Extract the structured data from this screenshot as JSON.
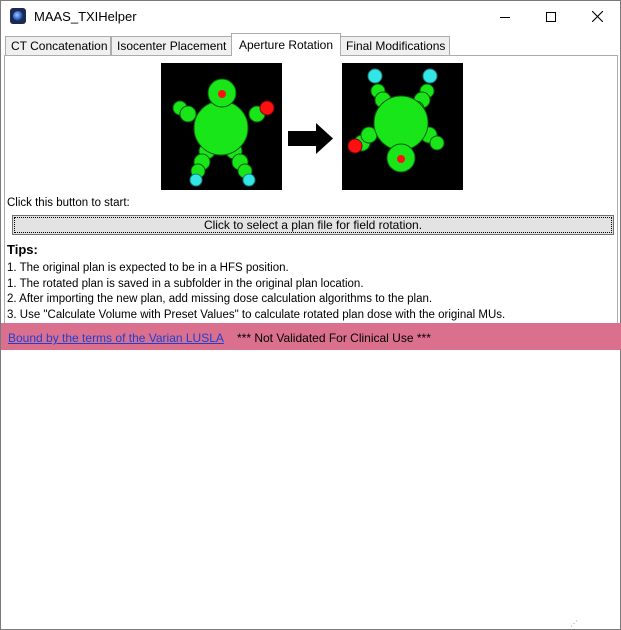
{
  "window": {
    "title": "MAAS_TXIHelper",
    "controls": [
      "minimize-icon",
      "maximize-icon",
      "close-icon"
    ]
  },
  "tabs": [
    {
      "label": "CT Concatenation",
      "active": false
    },
    {
      "label": "Isocenter Placement",
      "active": false
    },
    {
      "label": "Aperture Rotation",
      "active": true
    },
    {
      "label": "Final Modifications",
      "active": false
    }
  ],
  "main": {
    "start_label": "Click this button to start:",
    "select_button": "Click to select a plan file for field rotation.",
    "tips_heading": "Tips:",
    "tips": [
      "1. The original plan is expected to be in a HFS position.",
      "1. The rotated plan is saved in a subfolder in the original plan location.",
      "2. After importing the new plan, add missing dose calculation algorithms to the plan.",
      "3. Use \"Calculate Volume with Preset Values\" to calculate rotated plan dose with the original MUs."
    ],
    "diagram_icons": [
      "hfs-patient-icon",
      "right-arrow-icon",
      "rotated-patient-icon"
    ]
  },
  "footer": {
    "link": "Bound by the terms of the Varian LUSLA",
    "warning": "*** Not Validated For Clinical Use ***",
    "color": "#db6f8e"
  },
  "colors": {
    "body_green": "#19e619",
    "marker_red": "#ff1010",
    "marker_cyan": "#33e6e6",
    "diagram_bg": "#000000"
  }
}
